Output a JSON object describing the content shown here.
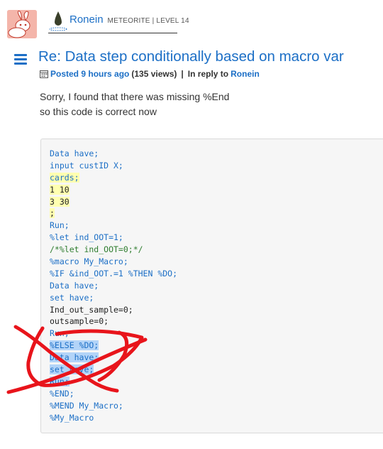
{
  "author": {
    "name": "Ronein",
    "rank": "METEORITE | LEVEL 14"
  },
  "post": {
    "title": "Re: Data step conditionally based on macro var",
    "posted_label": "Posted",
    "posted_time": "9 hours ago",
    "views": "(135 views)",
    "separator": "|",
    "reply_label": "In reply to",
    "reply_to": "Ronein",
    "body_lines": [
      "Sorry, I found that there was missing %End",
      "so this code is correct now"
    ]
  },
  "code": {
    "lines": [
      "Data have;",
      "input custID X;",
      "cards;",
      "1 10",
      "3 30",
      ";",
      "Run;",
      "%let ind_OOT=1;",
      "/*%let ind_OOT=0;*/",
      "%macro My_Macro;",
      "%IF &ind_OOT.=1 %THEN %DO;",
      "Data have;",
      "set have;",
      "Ind_out_sample=0;",
      "outsample=0;",
      "Run;",
      "%ELSE %DO;",
      "Data have;",
      "set have;",
      "Run;",
      "%END;",
      "%MEND My_Macro;",
      "%My_Macro"
    ],
    "highlight_yellow": [
      2,
      3,
      4,
      5
    ],
    "highlight_blue": [
      16,
      17,
      18,
      19
    ]
  },
  "colors": {
    "link": "#1c6fc6",
    "scribble": "#e8141b",
    "highlight_yellow": "#ffffb0",
    "highlight_blue": "#b3d4f8"
  },
  "icons": {
    "avatar": "rabbit-avatar",
    "rank": "meteorite-drop-icon",
    "menu": "hamburger-menu-icon",
    "calendar": "calendar-icon"
  }
}
